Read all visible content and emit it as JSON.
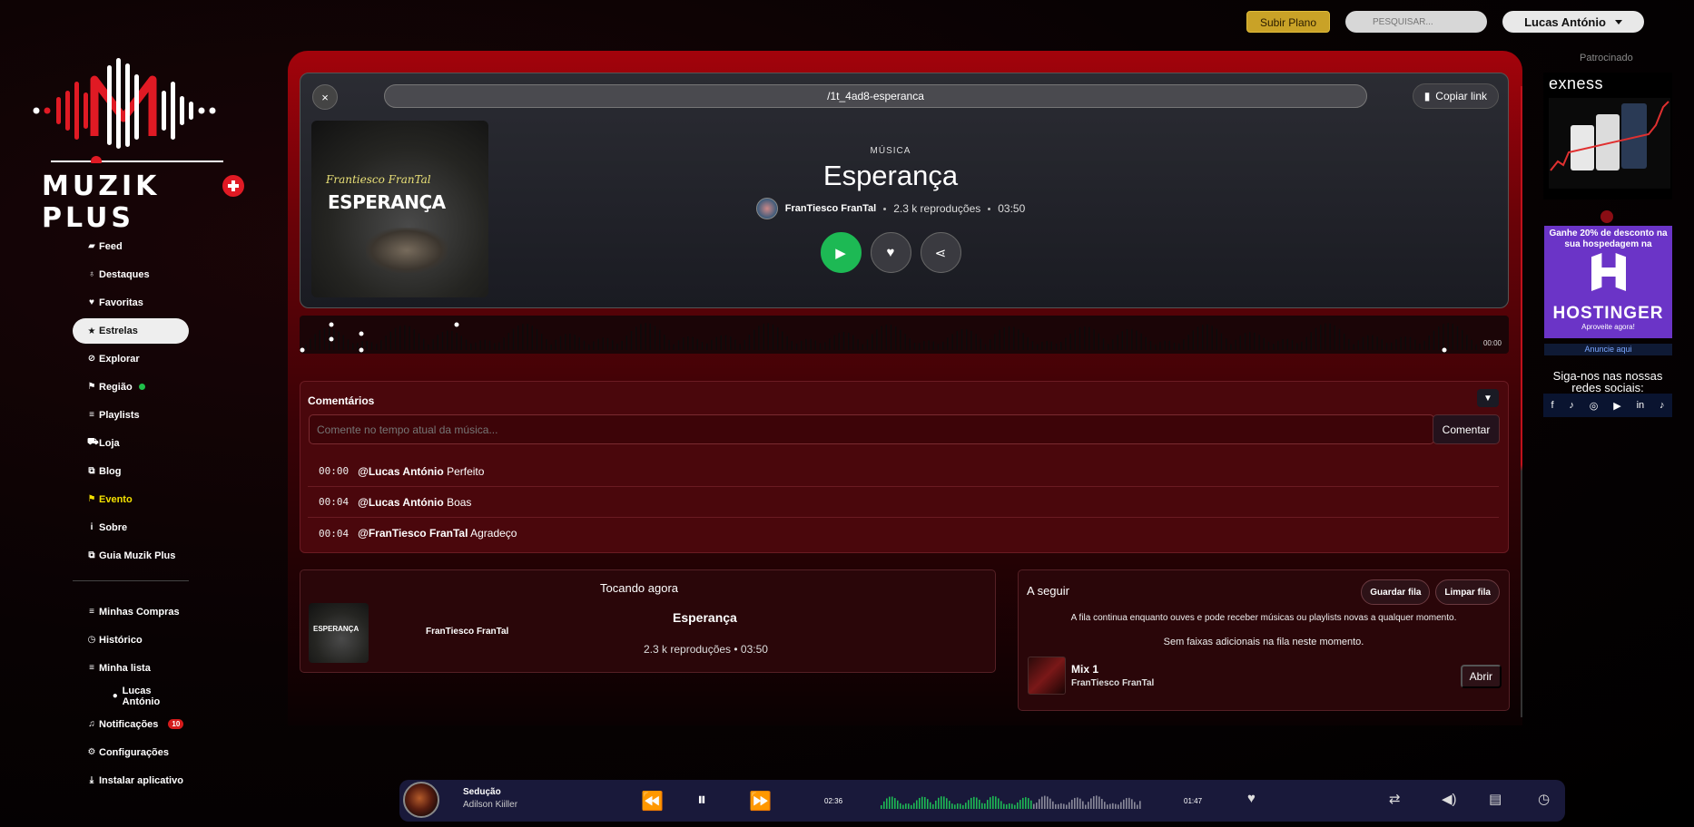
{
  "topbar": {
    "upgrade_label": "Subir Plano",
    "search_placeholder": "PESQUISAR...",
    "user_name": "Lucas António"
  },
  "logo": {
    "text": "MUZIK PLUS"
  },
  "nav": {
    "items": [
      {
        "label": "Feed",
        "icon": "feed-icon"
      },
      {
        "label": "Destaques",
        "icon": "lightbulb-icon"
      },
      {
        "label": "Favoritas",
        "icon": "heart-icon"
      },
      {
        "label": "Estrelas",
        "icon": "star-icon"
      },
      {
        "label": "Explorar",
        "icon": "compass-icon"
      },
      {
        "label": "Região",
        "icon": "flag-icon"
      },
      {
        "label": "Playlists",
        "icon": "list-icon"
      },
      {
        "label": "Loja",
        "icon": "cart-icon"
      },
      {
        "label": "Blog",
        "icon": "blog-icon"
      },
      {
        "label": "Evento",
        "icon": "event-flag-icon"
      },
      {
        "label": "Sobre",
        "icon": "info-icon"
      },
      {
        "label": "Guia Muzik Plus",
        "icon": "guide-icon"
      }
    ],
    "secondary": [
      {
        "label": "Minhas Compras",
        "icon": "list-icon"
      },
      {
        "label": "Histórico",
        "icon": "clock-icon"
      },
      {
        "label": "Minha lista",
        "icon": "list-icon"
      },
      {
        "label": "Lucas António",
        "icon": "user-icon"
      },
      {
        "label": "Notificações",
        "icon": "bell-icon",
        "badge": "10"
      },
      {
        "label": "Configurações",
        "icon": "gear-icon"
      },
      {
        "label": "Instalar aplicativo",
        "icon": "download-icon"
      }
    ]
  },
  "hero": {
    "close_label": "×",
    "url": "/1t_4ad8-esperanca",
    "copy_label": "Copiar link",
    "cover_script": "Frantiesco FranTal",
    "cover_title": "ESPERANÇA",
    "genre": "MÚSICA",
    "title": "Esperança",
    "artist": "FranTiesco FranTal",
    "plays": "2.3 k reproduções",
    "duration": "03:50"
  },
  "wave": {
    "time": "00:00"
  },
  "comments": {
    "heading": "Comentários",
    "input_placeholder": "Comente no tempo atual da música...",
    "submit_label": "Comentar",
    "items": [
      {
        "time": "00:00",
        "user": "@Lucas António",
        "text": "Perfeito"
      },
      {
        "time": "00:04",
        "user": "@Lucas António",
        "text": "Boas"
      },
      {
        "time": "00:04",
        "user": "@FranTiesco FranTal",
        "text": "Agradeço"
      }
    ]
  },
  "now_playing": {
    "heading": "Tocando agora",
    "cover_label": "ESPERANÇA",
    "artist": "FranTiesco FranTal",
    "title": "Esperança",
    "meta": "2.3 k reproduções • 03:50"
  },
  "queue": {
    "heading": "A seguir",
    "save_label": "Guardar fila",
    "clear_label": "Limpar fila",
    "info": "A fila continua enquanto ouves e pode receber músicas ou playlists novas a qualquer momento.",
    "empty": "Sem faixas adicionais na fila neste momento.",
    "item_title": "Mix 1",
    "item_artist": "FranTiesco FranTal",
    "open_label": "Abrir"
  },
  "sidebar_right": {
    "sponsored": "Patrocinado",
    "ad1_brand": "exness",
    "ad2_text": "Ganhe 20% de desconto na sua hospedagem na",
    "ad2_brand": "HOSTINGER",
    "ad2_sub": "Aproveite agora!",
    "ad_link": "Anuncie aqui",
    "social_heading": "Siga-nos nas nossas redes sociais:"
  },
  "player": {
    "title": "Sedução",
    "artist": "Adilson Kiiller",
    "elapsed": "02:36",
    "remaining": "01:47"
  },
  "colors": {
    "accent_red": "#a3030b",
    "play_green": "#1db954",
    "upgrade_gold": "#c9a227",
    "event_yellow": "#f2e000"
  }
}
